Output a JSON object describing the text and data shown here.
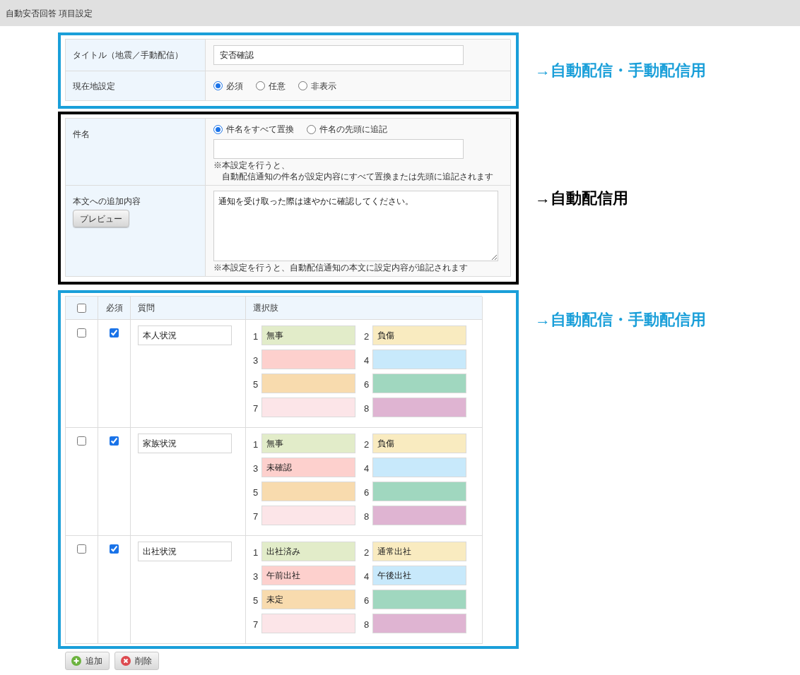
{
  "header": {
    "title": "自動安否回答 項目設定"
  },
  "sections": [
    {
      "kind": "form",
      "color": "#1a9fd9",
      "annotation": "→自動配信・手動配信用",
      "rows": [
        {
          "label": "タイトル（地震／手動配信）",
          "fields": [
            {
              "kind": "input",
              "value": "安否確認"
            }
          ]
        },
        {
          "label": "現在地設定",
          "fields": [
            {
              "kind": "radios",
              "options": [
                {
                  "label": "必須",
                  "selected": true
                },
                {
                  "label": "任意",
                  "selected": false
                },
                {
                  "label": "非表示",
                  "selected": false
                }
              ]
            }
          ]
        }
      ]
    },
    {
      "kind": "form",
      "color": "#000000",
      "annotation": "→自動配信用",
      "rows": [
        {
          "label": "件名",
          "fields": [
            {
              "kind": "radios",
              "options": [
                {
                  "label": "件名をすべて置換",
                  "selected": true
                },
                {
                  "label": "件名の先頭に追記",
                  "selected": false
                }
              ]
            },
            {
              "kind": "input"
            },
            {
              "kind": "note",
              "lines": [
                "※本設定を行うと、",
                "自動配信通知の件名が設定内容にすべて置換または先頭に追記されます"
              ]
            }
          ]
        },
        {
          "label": "本文への追加内容",
          "button": "プレビュー",
          "fields": [
            {
              "kind": "textarea",
              "value": "通知を受け取った際は速やかに確認してください。"
            },
            {
              "kind": "note",
              "lines": [
                "※本設定を行うと、自動配信通知の本文に設定内容が追記されます"
              ]
            }
          ]
        }
      ]
    },
    {
      "kind": "table",
      "color": "#1a9fd9",
      "annotation": "→自動配信・手動配信用",
      "header": {
        "checked": false,
        "columns": [
          "必須",
          "質問",
          "選択肢"
        ]
      },
      "rows": [
        {
          "checked": false,
          "required": true,
          "question": "本人状況",
          "choices": [
            {
              "number": "1",
              "value": "無事",
              "color": "#e2ecc9"
            },
            {
              "number": "2",
              "value": "負傷",
              "color": "#f9ebc0"
            },
            {
              "number": "3",
              "color": "#fdd0cd"
            },
            {
              "number": "4",
              "color": "#c8e9fb"
            },
            {
              "number": "5",
              "color": "#f8dbae"
            },
            {
              "number": "6",
              "color": "#a0d7bf"
            },
            {
              "number": "7",
              "color": "#fce5e8"
            },
            {
              "number": "8",
              "color": "#dfb4d2"
            }
          ]
        },
        {
          "checked": false,
          "required": true,
          "question": "家族状況",
          "choices": [
            {
              "number": "1",
              "value": "無事",
              "color": "#e2ecc9"
            },
            {
              "number": "2",
              "value": "負傷",
              "color": "#f9ebc0"
            },
            {
              "number": "3",
              "value": "未確認",
              "color": "#fdd0cd"
            },
            {
              "number": "4",
              "color": "#c8e9fb"
            },
            {
              "number": "5",
              "color": "#f8dbae"
            },
            {
              "number": "6",
              "color": "#a0d7bf"
            },
            {
              "number": "7",
              "color": "#fce5e8"
            },
            {
              "number": "8",
              "color": "#dfb4d2"
            }
          ]
        },
        {
          "checked": false,
          "required": true,
          "question": "出社状況",
          "choices": [
            {
              "number": "1",
              "value": "出社済み",
              "color": "#e2ecc9"
            },
            {
              "number": "2",
              "value": "通常出社",
              "color": "#f9ebc0"
            },
            {
              "number": "3",
              "value": "午前出社",
              "color": "#fdd0cd"
            },
            {
              "number": "4",
              "value": "午後出社",
              "color": "#c8e9fb"
            },
            {
              "number": "5",
              "value": "未定",
              "color": "#f8dbae"
            },
            {
              "number": "6",
              "color": "#a0d7bf"
            },
            {
              "number": "7",
              "color": "#fce5e8"
            },
            {
              "number": "8",
              "color": "#dfb4d2"
            }
          ]
        }
      ],
      "buttons": [
        {
          "kind": "add",
          "label": "追加"
        },
        {
          "kind": "delete",
          "label": "削除"
        }
      ]
    }
  ]
}
